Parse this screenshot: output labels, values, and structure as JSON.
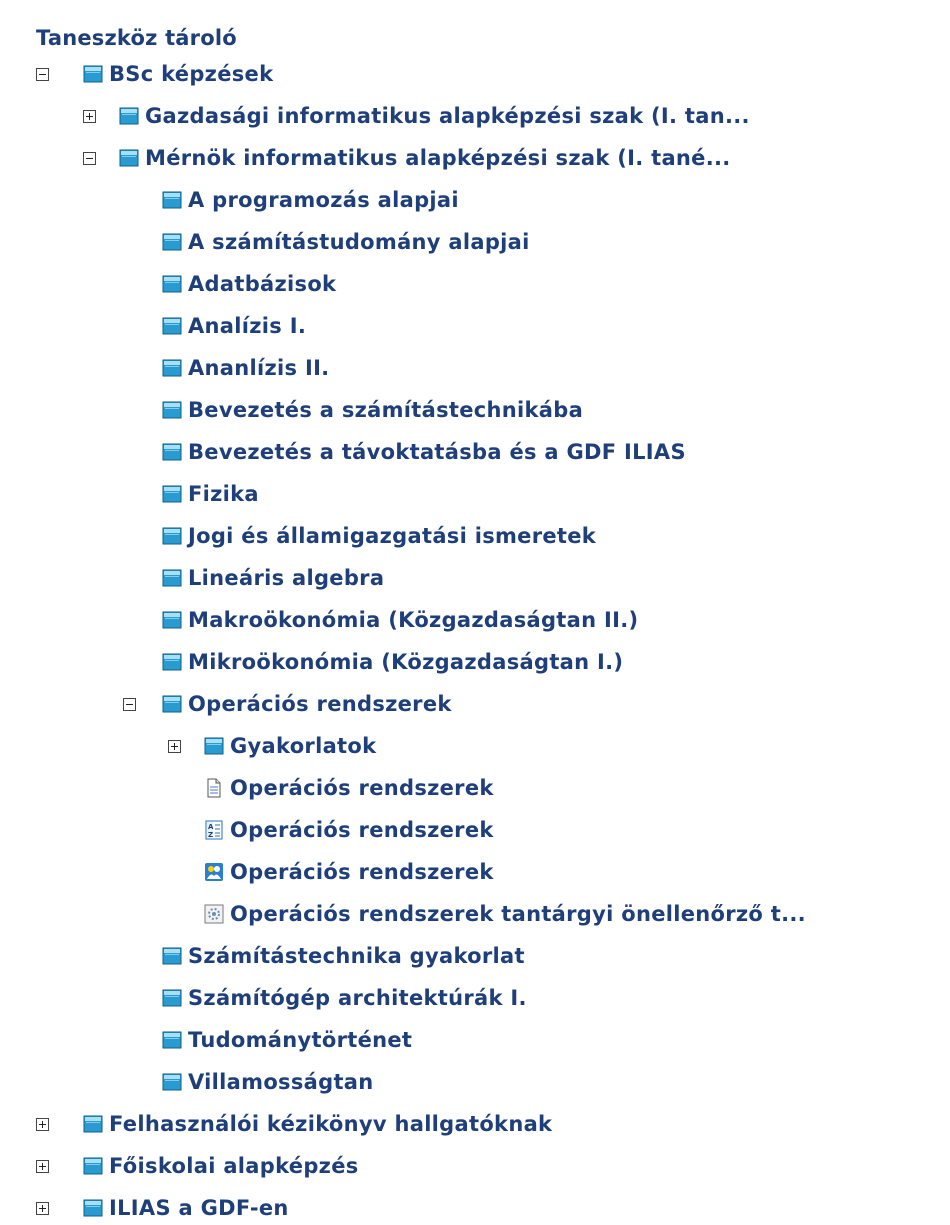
{
  "tree": {
    "title": "Taneszköz tároló",
    "rows": [
      {
        "label": "BSc képzések",
        "icon": "folder-icon",
        "toggle": "minus"
      },
      {
        "label": "Gazdasági informatikus alapképzési szak (I. tan...",
        "icon": "folder-icon",
        "toggle": "plus"
      },
      {
        "label": "Mérnök informatikus alapképzési szak (I. tané...",
        "icon": "folder-icon",
        "toggle": "minus"
      },
      {
        "label": "A programozás alapjai",
        "icon": "folder-icon",
        "toggle": "none"
      },
      {
        "label": "A számítástudomány alapjai",
        "icon": "folder-icon",
        "toggle": "none"
      },
      {
        "label": "Adatbázisok",
        "icon": "folder-icon",
        "toggle": "none"
      },
      {
        "label": "Analízis I.",
        "icon": "folder-icon",
        "toggle": "none"
      },
      {
        "label": "Ananlízis II.",
        "icon": "folder-icon",
        "toggle": "none"
      },
      {
        "label": "Bevezetés a számítástechnikába",
        "icon": "folder-icon",
        "toggle": "none"
      },
      {
        "label": "Bevezetés a távoktatásba és a GDF ILIAS",
        "icon": "folder-icon",
        "toggle": "none"
      },
      {
        "label": "Fizika",
        "icon": "folder-icon",
        "toggle": "none"
      },
      {
        "label": "Jogi és államigazgatási ismeretek",
        "icon": "folder-icon",
        "toggle": "none"
      },
      {
        "label": "Lineáris algebra",
        "icon": "folder-icon",
        "toggle": "none"
      },
      {
        "label": "Makroökonómia (Közgazdaságtan II.)",
        "icon": "folder-icon",
        "toggle": "none"
      },
      {
        "label": "Mikroökonómia (Közgazdaságtan I.)",
        "icon": "folder-icon",
        "toggle": "none"
      },
      {
        "label": "Operációs rendszerek",
        "icon": "folder-icon",
        "toggle": "minus"
      },
      {
        "label": "Gyakorlatok",
        "icon": "folder-icon",
        "toggle": "plus"
      },
      {
        "label": "Operációs rendszerek",
        "icon": "document-icon",
        "toggle": "none"
      },
      {
        "label": "Operációs rendszerek",
        "icon": "glossary-icon",
        "toggle": "none"
      },
      {
        "label": "Operációs rendszerek",
        "icon": "forum-icon",
        "toggle": "none"
      },
      {
        "label": "Operációs rendszerek tantárgyi önellenőrző t...",
        "icon": "test-icon",
        "toggle": "none"
      },
      {
        "label": "Számítástechnika gyakorlat",
        "icon": "folder-icon",
        "toggle": "none"
      },
      {
        "label": "Számítógép architektúrák I.",
        "icon": "folder-icon",
        "toggle": "none"
      },
      {
        "label": "Tudománytörténet",
        "icon": "folder-icon",
        "toggle": "none"
      },
      {
        "label": "Villamosságtan",
        "icon": "folder-icon",
        "toggle": "none"
      },
      {
        "label": "Felhasználói kézikönyv hallgatóknak",
        "icon": "folder-icon",
        "toggle": "plus"
      },
      {
        "label": "Főiskolai alapképzés",
        "icon": "folder-icon",
        "toggle": "plus"
      },
      {
        "label": "ILIAS a GDF-en",
        "icon": "folder-icon",
        "toggle": "plus"
      }
    ]
  },
  "colors": {
    "text": "#1e3f7a",
    "folder_teal": "#2a9bd1",
    "folder_tab": "#a9dff5"
  }
}
